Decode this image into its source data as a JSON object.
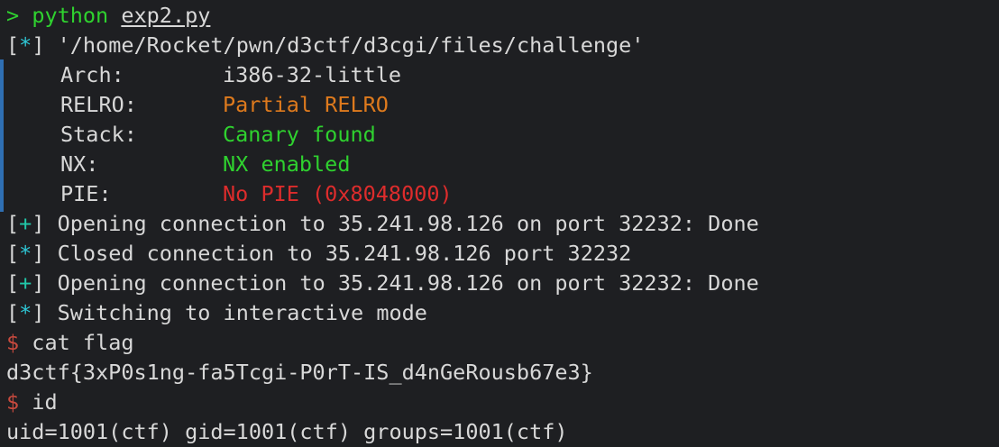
{
  "terminal": {
    "line1": {
      "prompt": ">",
      "command": "python",
      "argument": "exp2.py"
    },
    "line2": {
      "bracket_open": "[",
      "marker": "*",
      "bracket_close": "]",
      "text": " '/home/Rocket/pwn/d3ctf/d3cgi/files/challenge'"
    },
    "checksec": [
      {
        "label": "Arch:",
        "value": "i386-32-little"
      },
      {
        "label": "RELRO:",
        "value": "Partial RELRO"
      },
      {
        "label": "Stack:",
        "value": "Canary found"
      },
      {
        "label": "NX:",
        "value": "NX enabled"
      },
      {
        "label": "PIE:",
        "value": "No PIE (0x8048000)"
      }
    ],
    "status_lines": [
      {
        "marker": "+",
        "text": " Opening connection to 35.241.98.126 on port 32232: Done"
      },
      {
        "marker": "*",
        "text": " Closed connection to 35.241.98.126 port 32232"
      },
      {
        "marker": "+",
        "text": " Opening connection to 35.241.98.126 on port 32232: Done"
      },
      {
        "marker": "*",
        "text": " Switching to interactive mode"
      }
    ],
    "shell": {
      "prompt1": "$",
      "cmd1": " cat flag",
      "output1": "d3ctf{3xP0s1ng-fa5Tcgi-P0rT-IS_d4nGeRousb67e3}",
      "prompt2": "$",
      "cmd2": " id",
      "output2": "uid=1001(ctf) gid=1001(ctf) groups=1001(ctf)"
    }
  },
  "colors": {
    "background": "#1e1f22",
    "text": "#d8d8d8",
    "green": "#2fd12f",
    "cyan": "#2ec7d6",
    "orange": "#de7a1d",
    "red": "#dd2c2c",
    "bar": "#2f6fb3"
  }
}
